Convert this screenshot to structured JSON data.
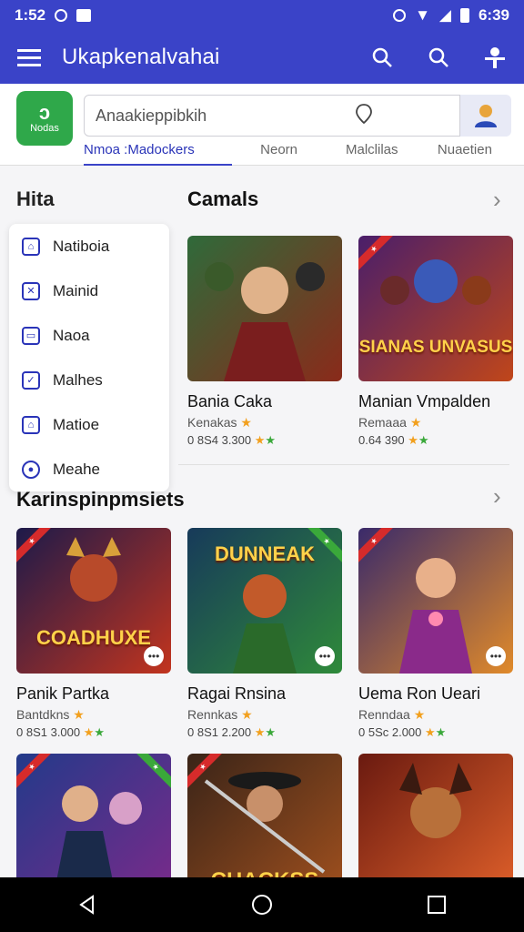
{
  "status_bar": {
    "time": "1:52",
    "battery_time": "6:39"
  },
  "app_bar": {
    "title": "Ukapkenalvahai"
  },
  "header": {
    "logo_glyph": "ɔ",
    "logo_label": "Nodas",
    "search_value": "Anaakieppibkih",
    "tabs": [
      {
        "label": "Nmoa :Madockers"
      },
      {
        "label": "Neorn"
      },
      {
        "label": "Malclilas"
      },
      {
        "label": "Nuaetien"
      }
    ]
  },
  "sidebar": {
    "title": "Hita",
    "items": [
      {
        "label": "Natiboia"
      },
      {
        "label": "Mainid"
      },
      {
        "label": "Naoa"
      },
      {
        "label": "Malhes"
      },
      {
        "label": "Matioe"
      },
      {
        "label": "Meahe"
      }
    ]
  },
  "section1": {
    "title": "Camals",
    "cards": [
      {
        "name": "Bania Caka",
        "sub": "Kenakas",
        "meta": "0 8S4 3.300",
        "art": "",
        "colors": [
          "#2f6a3a",
          "#8a2a1a"
        ]
      },
      {
        "name": "Manian Vmpalden",
        "sub": "Remaaa",
        "meta": "0.64 390",
        "art": "SIANAS UNVASUS",
        "colors": [
          "#4a1e6a",
          "#c0461a"
        ]
      }
    ]
  },
  "section2": {
    "title": "Karinspinpmsiets",
    "cards": [
      {
        "name": "Panik Partka",
        "sub": "Bantdkns",
        "meta": "0 8S1 3.000",
        "art": "COADHUXE",
        "art_top": false,
        "colors": [
          "#1d1a4a",
          "#c2341e"
        ]
      },
      {
        "name": "Ragai Rnsina",
        "sub": "Rennkas",
        "meta": "0 8S1 2.200",
        "art": "DUNNEAK",
        "art_top": true,
        "colors": [
          "#173a5a",
          "#2f8a3a"
        ]
      },
      {
        "name": "Uema Ron Ueari",
        "sub": "Renndaa",
        "meta": "0 5Sc 2.000",
        "art": "",
        "art_top": false,
        "colors": [
          "#3a2a6a",
          "#e08a2a"
        ]
      }
    ]
  },
  "section3": {
    "cards": [
      {
        "art": "",
        "colors": [
          "#233a8a",
          "#7a2a8a"
        ]
      },
      {
        "art": "CHACKSS",
        "colors": [
          "#3a2418",
          "#a0501e"
        ]
      },
      {
        "art": "",
        "colors": [
          "#6a1a10",
          "#e0602a"
        ]
      }
    ]
  }
}
